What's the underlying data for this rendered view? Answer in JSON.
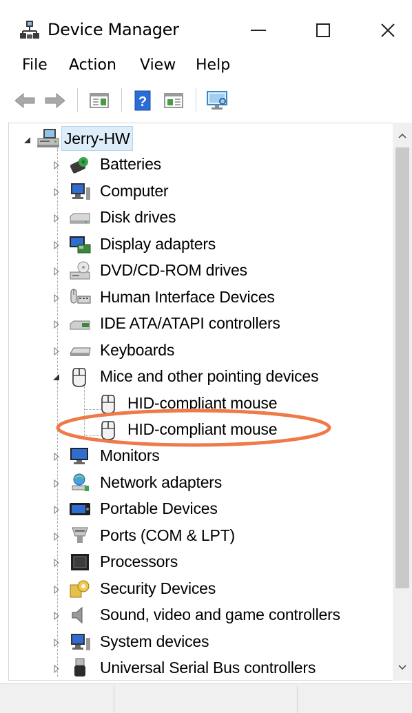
{
  "window": {
    "title": "Device Manager",
    "minimize_glyph": "—",
    "close_glyph": "✕"
  },
  "menu": {
    "items": [
      "File",
      "Action",
      "View",
      "Help"
    ]
  },
  "toolbar": {
    "buttons": [
      "back-icon",
      "forward-icon",
      "properties-icon",
      "help-icon",
      "update-driver-icon",
      "scan-hardware-icon"
    ]
  },
  "tree": {
    "root": {
      "label": "Jerry-HW",
      "expanded": true
    },
    "categories": [
      {
        "label": "Batteries",
        "icon": "battery-icon",
        "expanded": false
      },
      {
        "label": "Computer",
        "icon": "computer-icon",
        "expanded": false
      },
      {
        "label": "Disk drives",
        "icon": "disk-drive-icon",
        "expanded": false
      },
      {
        "label": "Display adapters",
        "icon": "display-adapter-icon",
        "expanded": false
      },
      {
        "label": "DVD/CD-ROM drives",
        "icon": "dvd-drive-icon",
        "expanded": false
      },
      {
        "label": "Human Interface Devices",
        "icon": "hid-icon",
        "expanded": false
      },
      {
        "label": "IDE ATA/ATAPI controllers",
        "icon": "ide-controller-icon",
        "expanded": false
      },
      {
        "label": "Keyboards",
        "icon": "keyboard-icon",
        "expanded": false
      },
      {
        "label": "Mice and other pointing devices",
        "icon": "mouse-icon",
        "expanded": true,
        "children": [
          "HID-compliant mouse",
          "HID-compliant mouse"
        ]
      },
      {
        "label": "Monitors",
        "icon": "monitor-icon",
        "expanded": false
      },
      {
        "label": "Network adapters",
        "icon": "network-adapter-icon",
        "expanded": false
      },
      {
        "label": "Portable Devices",
        "icon": "portable-device-icon",
        "expanded": false
      },
      {
        "label": "Ports (COM & LPT)",
        "icon": "port-icon",
        "expanded": false
      },
      {
        "label": "Processors",
        "icon": "processor-icon",
        "expanded": false
      },
      {
        "label": "Security Devices",
        "icon": "security-device-icon",
        "expanded": false
      },
      {
        "label": "Sound, video and game controllers",
        "icon": "sound-icon",
        "expanded": false
      },
      {
        "label": "System devices",
        "icon": "system-device-icon",
        "expanded": false
      },
      {
        "label": "Universal Serial Bus controllers",
        "icon": "usb-icon",
        "expanded": false
      }
    ]
  },
  "annotation": {
    "color": "#ee7a4a"
  },
  "colors": {
    "selection_bg": "#ddeefa",
    "selection_border": "#b4d6ee",
    "accent_blue": "#1f5fbf"
  }
}
